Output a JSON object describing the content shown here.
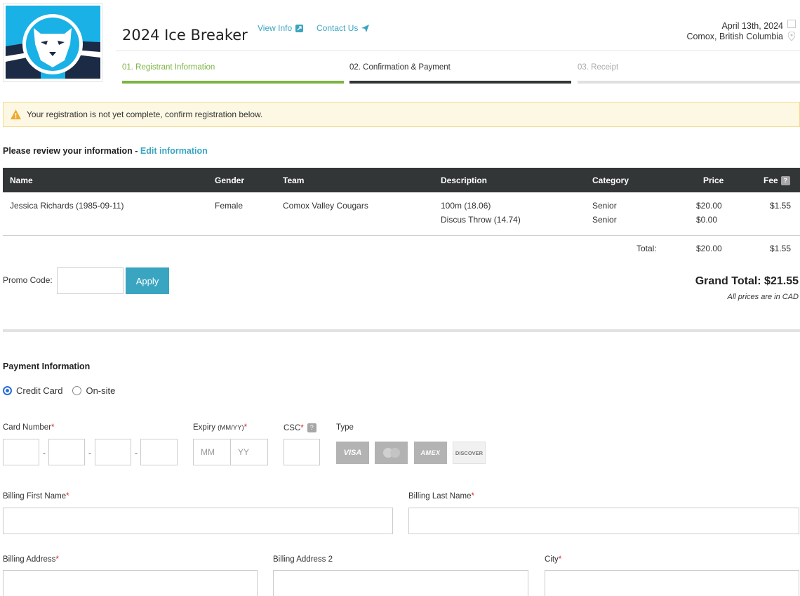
{
  "header": {
    "event_title": "2024 Ice Breaker",
    "view_info_label": "View Info",
    "contact_label": "Contact Us",
    "date": "April 13th, 2024",
    "location": "Comox, British Columbia"
  },
  "steps": [
    {
      "label": "01. Registrant Information",
      "state": "done",
      "color": "#7cb342"
    },
    {
      "label": "02. Confirmation & Payment",
      "state": "active",
      "color": "#333637"
    },
    {
      "label": "03. Receipt",
      "state": "pending",
      "color": "#e0e0e0"
    }
  ],
  "alert": {
    "text": "Your registration is not yet complete, confirm registration below.",
    "color": "#f0a92a"
  },
  "review": {
    "heading": "Please review your information -",
    "edit_link": "Edit information"
  },
  "table": {
    "headers": {
      "name": "Name",
      "gender": "Gender",
      "team": "Team",
      "description": "Description",
      "category": "Category",
      "price": "Price",
      "fee": "Fee"
    },
    "fee_help": "?",
    "row": {
      "name": "Jessica Richards (1985-09-11)",
      "gender": "Female",
      "team": "Comox Valley Cougars",
      "fee": "$1.55",
      "events": [
        {
          "description": "100m (18.06)",
          "category": "Senior",
          "price": "$20.00"
        },
        {
          "description": "Discus Throw (14.74)",
          "category": "Senior",
          "price": "$0.00"
        }
      ]
    },
    "total_label": "Total:",
    "total_price": "$20.00",
    "total_fee": "$1.55"
  },
  "promo": {
    "label": "Promo Code:",
    "value": "",
    "apply_label": "Apply"
  },
  "grand_total": "Grand Total: $21.55",
  "currency_note": "All prices are in CAD",
  "payment": {
    "title": "Payment Information",
    "methods": [
      {
        "label": "Credit Card",
        "selected": true
      },
      {
        "label": "On-site",
        "selected": false
      }
    ],
    "card_number_label": "Card Number",
    "expiry_label": "Expiry",
    "expiry_hint": "(MM/YY)",
    "expiry_mm_placeholder": "MM",
    "expiry_yy_placeholder": "YY",
    "csc_label": "CSC",
    "csc_help": "?",
    "type_label": "Type",
    "card_types": [
      "VISA",
      "MasterCard",
      "AMEX",
      "DISCOVER"
    ],
    "required_mark": "*",
    "billing_first_label": "Billing First Name",
    "billing_last_label": "Billing Last Name",
    "billing_address_label": "Billing Address",
    "billing_address2_label": "Billing Address 2",
    "city_label": "City"
  },
  "accent_color": "#3aa5c1"
}
